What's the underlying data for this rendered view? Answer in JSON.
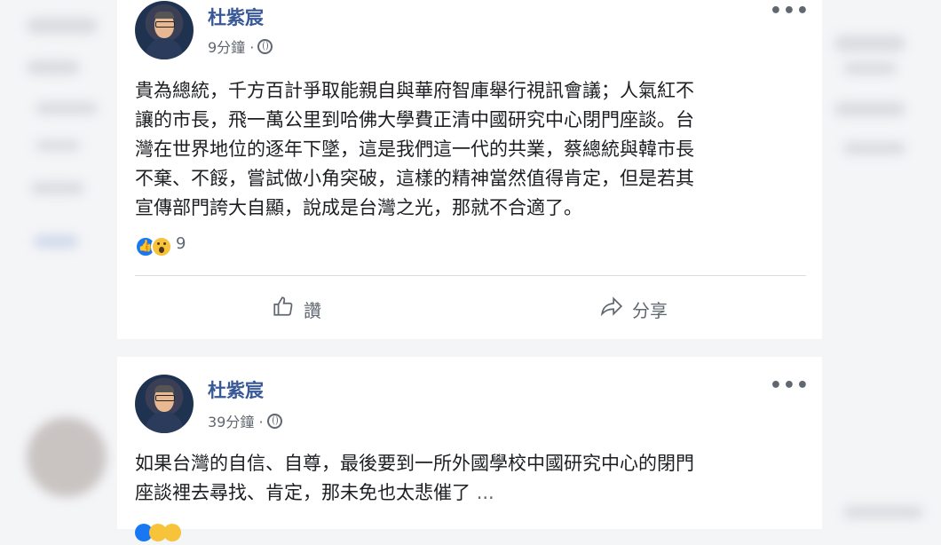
{
  "posts": [
    {
      "author": "杜紫宸",
      "time": "9分鐘 ·",
      "body_lines": [
        "貴為總統，千方百計爭取能親自與華府智庫舉行視訊會議；人氣紅不",
        "讓的市長，飛一萬公里到哈佛大學費正清中國研究中心閉門座談。台",
        "灣在世界地位的逐年下墜，這是我們這一代的共業，蔡總統與韓市長",
        "不棄、不餒，嘗試做小角突破，這樣的精神當然值得肯定，但是若其",
        "宣傳部門誇大自顯，說成是台灣之光，那就不合適了。"
      ],
      "reaction_count": "9",
      "like_label": "讚",
      "share_label": "分享"
    },
    {
      "author": "杜紫宸",
      "time": "39分鐘 ·",
      "body_lines": [
        "如果台灣的自信、自尊，最後要到一所外國學校中國研究中心的閉門",
        "座談裡去尋找、肯定，那未免也太悲催了"
      ],
      "ellipsis": "..."
    }
  ],
  "icons": {
    "more": "more-options-icon",
    "globe": "globe-icon",
    "like": "thumbs-up-icon",
    "share": "share-arrow-icon"
  },
  "colors": {
    "author": "#385898",
    "like_reaction": "#1877f2",
    "wow_reaction": "#f7c33b"
  }
}
